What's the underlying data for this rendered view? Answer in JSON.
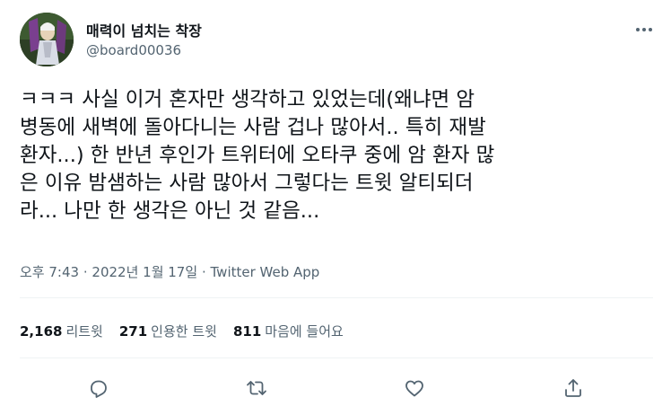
{
  "author": {
    "display_name": "매력이 넘치는 착장",
    "handle": "@board00036"
  },
  "tweet": {
    "lines": [
      "ㅋㅋㅋ 사실 이거 혼자만 생각하고 있었는데(왜냐면 암",
      "병동에 새벽에 돌아다니는 사람 겁나 많아서.. 특히 재발",
      "환자...) 한 반년 후인가 트위터에 오타쿠 중에 암 환자 많",
      "은 이유 밤샘하는 사람 많아서 그렇다는 트윗 알티되더",
      "라... 나만 한 생각은 아닌 것 같음..."
    ],
    "time": "오후 7:43",
    "separator": "·",
    "date": "2022년 1월 17일",
    "source": "Twitter Web App"
  },
  "stats": {
    "retweets_count": "2,168",
    "retweets_label": "리트윗",
    "quotes_count": "271",
    "quotes_label": "인용한 트윗",
    "likes_count": "811",
    "likes_label": "마음에 들어요"
  },
  "icons": {
    "more": "more-horizontal-icon",
    "reply": "reply-icon",
    "retweet": "retweet-icon",
    "like": "heart-icon",
    "share": "share-icon"
  },
  "colors": {
    "text_primary": "#0f1419",
    "text_secondary": "#536471",
    "divider": "#eff3f4"
  }
}
